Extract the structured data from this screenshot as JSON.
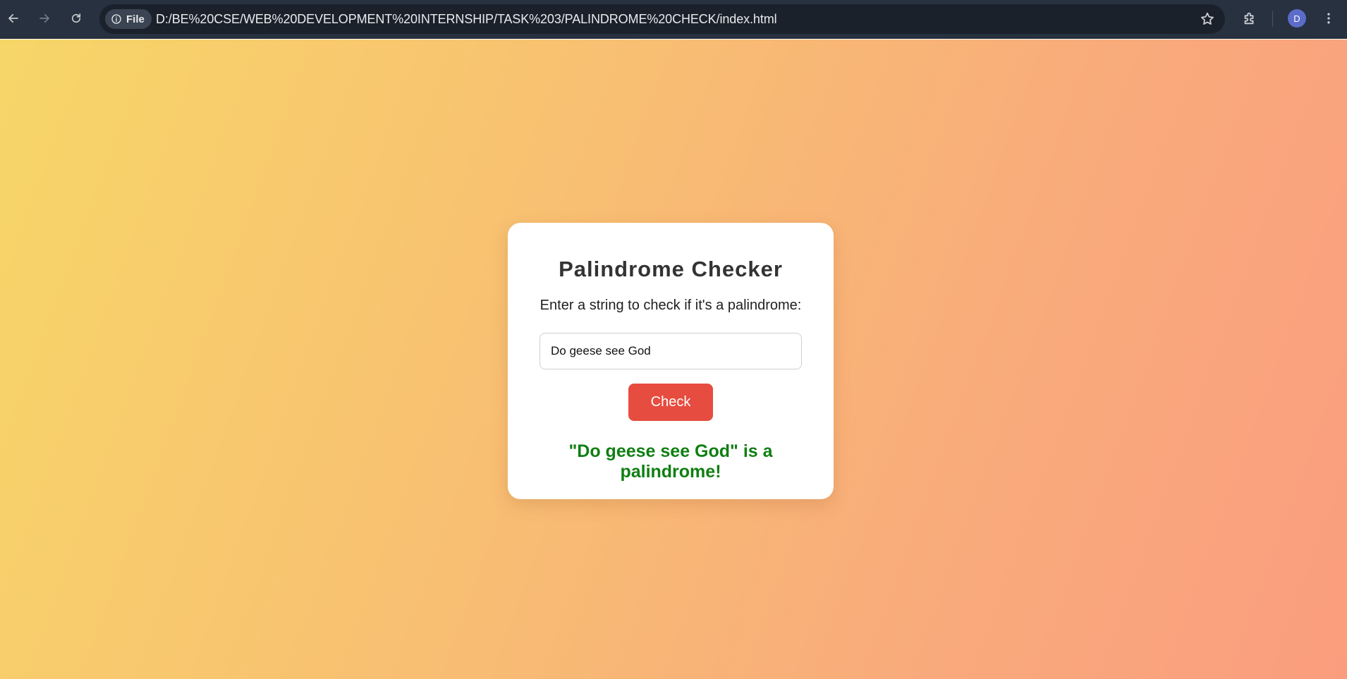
{
  "browser": {
    "site_chip_label": "File",
    "url": "D:/BE%20CSE/WEB%20DEVELOPMENT%20INTERNSHIP/TASK%203/PALINDROME%20CHECK/index.html",
    "profile_initial": "D"
  },
  "card": {
    "title": "Palindrome Checker",
    "prompt": "Enter a string to check if it's a palindrome:",
    "input_value": "Do geese see God",
    "button_label": "Check",
    "result_text": "\"Do geese see God\" is a palindrome!"
  },
  "colors": {
    "button": "#e64c3f",
    "result_success": "#0f7f12",
    "gradient_start": "#f7d668",
    "gradient_end": "#fa9d7e"
  }
}
